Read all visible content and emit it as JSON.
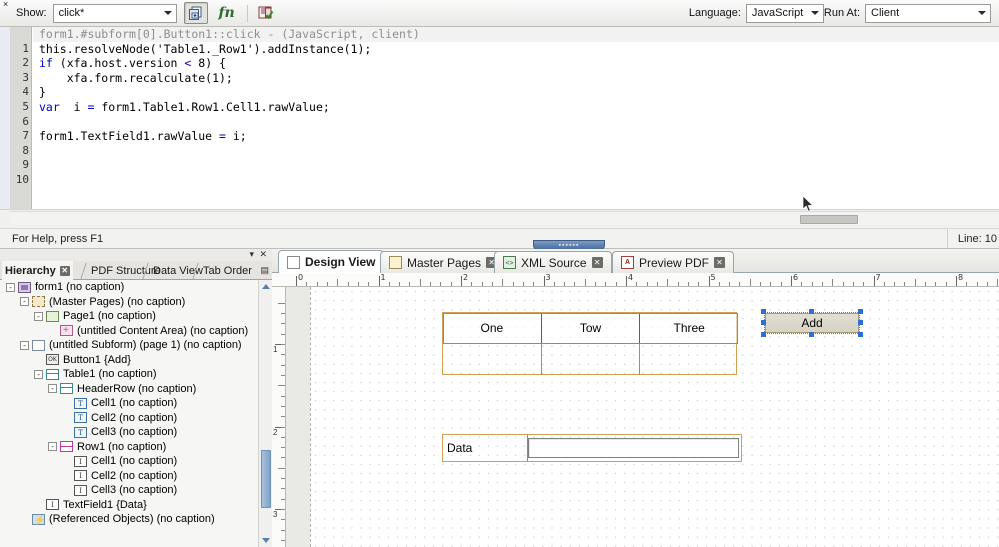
{
  "script_toolbar": {
    "close_icon": "×",
    "show_label": "Show:",
    "show_value": "click*",
    "btn_add_page": "add-page-icon",
    "btn_fn": "fn",
    "btn_validate": "validate-icon",
    "language_label": "Language:",
    "language_value": "JavaScript",
    "runat_label": "Run At:",
    "runat_value": "Client"
  },
  "code": {
    "header": "form1.#subform[0].Button1::click - (JavaScript, client)",
    "line_numbers": [
      "",
      "1",
      "2",
      "3",
      "4",
      "5",
      "6",
      "7",
      "8",
      "9",
      "10"
    ],
    "lines": [
      "this.resolveNode('Table1._Row1').addInstance(1);",
      "if (xfa.host.version < 8) {",
      "    xfa.form.recalculate(1);",
      "}",
      "var  i = form1.Table1.Row1.Cell1.rawValue;",
      "",
      "form1.TextField1.rawValue = i;",
      "",
      "",
      ""
    ]
  },
  "statusbar": {
    "help_text": "For Help, press F1",
    "line_indicator": "Line: 10"
  },
  "hierarchy_panel": {
    "minimize_icon": "▾",
    "close_icon": "✕",
    "tabs": [
      {
        "label": "Hierarchy",
        "active": true,
        "closable": true
      },
      {
        "label": "PDF Structure",
        "active": false,
        "closable": false
      },
      {
        "label": "Data View",
        "active": false,
        "closable": false
      },
      {
        "label": "Tab Order",
        "active": false,
        "closable": false
      }
    ],
    "menu_icon": "▤",
    "tree": [
      {
        "indent": 0,
        "expander": "-",
        "icon": "form-icon",
        "label": "form1 (no caption)"
      },
      {
        "indent": 1,
        "expander": "-",
        "icon": "master-pages-icon",
        "label": "(Master Pages) (no caption)"
      },
      {
        "indent": 2,
        "expander": "-",
        "icon": "page-icon",
        "label": "Page1 (no caption)"
      },
      {
        "indent": 3,
        "expander": "",
        "icon": "content-area-icon",
        "label": "(untitled Content Area) (no caption)"
      },
      {
        "indent": 1,
        "expander": "-",
        "icon": "subform-icon",
        "label": "(untitled Subform) (page 1) (no caption)"
      },
      {
        "indent": 2,
        "expander": "",
        "icon": "button-icon",
        "label": "Button1 {Add}"
      },
      {
        "indent": 2,
        "expander": "-",
        "icon": "table-icon",
        "label": "Table1 (no caption)"
      },
      {
        "indent": 3,
        "expander": "-",
        "icon": "table-icon",
        "label": "HeaderRow (no caption)"
      },
      {
        "indent": 4,
        "expander": "",
        "icon": "text-cell-icon",
        "label": "Cell1 (no caption)"
      },
      {
        "indent": 4,
        "expander": "",
        "icon": "text-cell-icon",
        "label": "Cell2 (no caption)"
      },
      {
        "indent": 4,
        "expander": "",
        "icon": "text-cell-icon",
        "label": "Cell3 (no caption)"
      },
      {
        "indent": 3,
        "expander": "-",
        "icon": "row-icon",
        "label": "Row1 (no caption)"
      },
      {
        "indent": 4,
        "expander": "",
        "icon": "field-icon",
        "label": "Cell1 (no caption)"
      },
      {
        "indent": 4,
        "expander": "",
        "icon": "field-icon",
        "label": "Cell2 (no caption)"
      },
      {
        "indent": 4,
        "expander": "",
        "icon": "field-icon",
        "label": "Cell3 (no caption)"
      },
      {
        "indent": 2,
        "expander": "",
        "icon": "field-icon",
        "label": "TextField1 {Data}"
      },
      {
        "indent": 1,
        "expander": "",
        "icon": "referenced-objects-icon",
        "label": "(Referenced Objects) (no caption)"
      }
    ]
  },
  "design_area": {
    "tabs": [
      {
        "label": "Design View",
        "icon": "page-icon",
        "active": true,
        "closable": false
      },
      {
        "label": "Master Pages",
        "icon": "master-page-icon",
        "active": false,
        "closable": true
      },
      {
        "label": "XML Source",
        "icon": "xml-icon",
        "active": false,
        "closable": true
      },
      {
        "label": "Preview PDF",
        "icon": "pdf-icon",
        "active": false,
        "closable": true
      }
    ],
    "ruler_h_labels": [
      "0",
      "1",
      "2",
      "3",
      "4",
      "5",
      "6",
      "7",
      "8"
    ],
    "ruler_v_labels": [
      "1",
      "2",
      "3"
    ],
    "table": {
      "header_cells": [
        "One",
        "Tow",
        "Three"
      ],
      "body_cells": [
        "",
        "",
        ""
      ]
    },
    "add_button": {
      "label": "Add",
      "selected": true
    },
    "data_field": {
      "label": "Data",
      "value": ""
    }
  }
}
